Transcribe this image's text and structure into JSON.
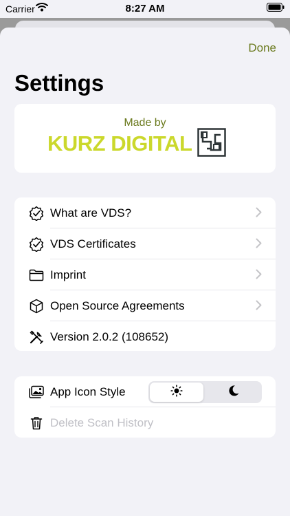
{
  "status_bar": {
    "carrier": "Carrier",
    "time": "8:27 AM"
  },
  "nav": {
    "done_label": "Done"
  },
  "page": {
    "title": "Settings"
  },
  "brand": {
    "made_by": "Made by",
    "name": "KURZ DIGITAL"
  },
  "info_group": {
    "items": [
      {
        "label": "What are VDS?",
        "icon": "badge-check-icon",
        "chevron": true
      },
      {
        "label": "VDS Certificates",
        "icon": "badge-check-icon",
        "chevron": true
      },
      {
        "label": "Imprint",
        "icon": "folder-icon",
        "chevron": true
      },
      {
        "label": "Open Source Agreements",
        "icon": "cube-icon",
        "chevron": true
      },
      {
        "label": "Version 2.0.2 (108652)",
        "icon": "tools-icon",
        "chevron": false
      }
    ]
  },
  "app_group": {
    "app_icon_style": {
      "label": "App Icon Style",
      "icon": "photo-stack-icon",
      "options": [
        "sun-icon",
        "moon-icon"
      ],
      "selected": "sun-icon"
    },
    "delete_history": {
      "label": "Delete Scan History",
      "icon": "trash-icon",
      "enabled": false
    }
  },
  "colors": {
    "accent": "#6b7a1e",
    "brand_yellow": "#cbd82c",
    "background": "#f2f2f7"
  }
}
